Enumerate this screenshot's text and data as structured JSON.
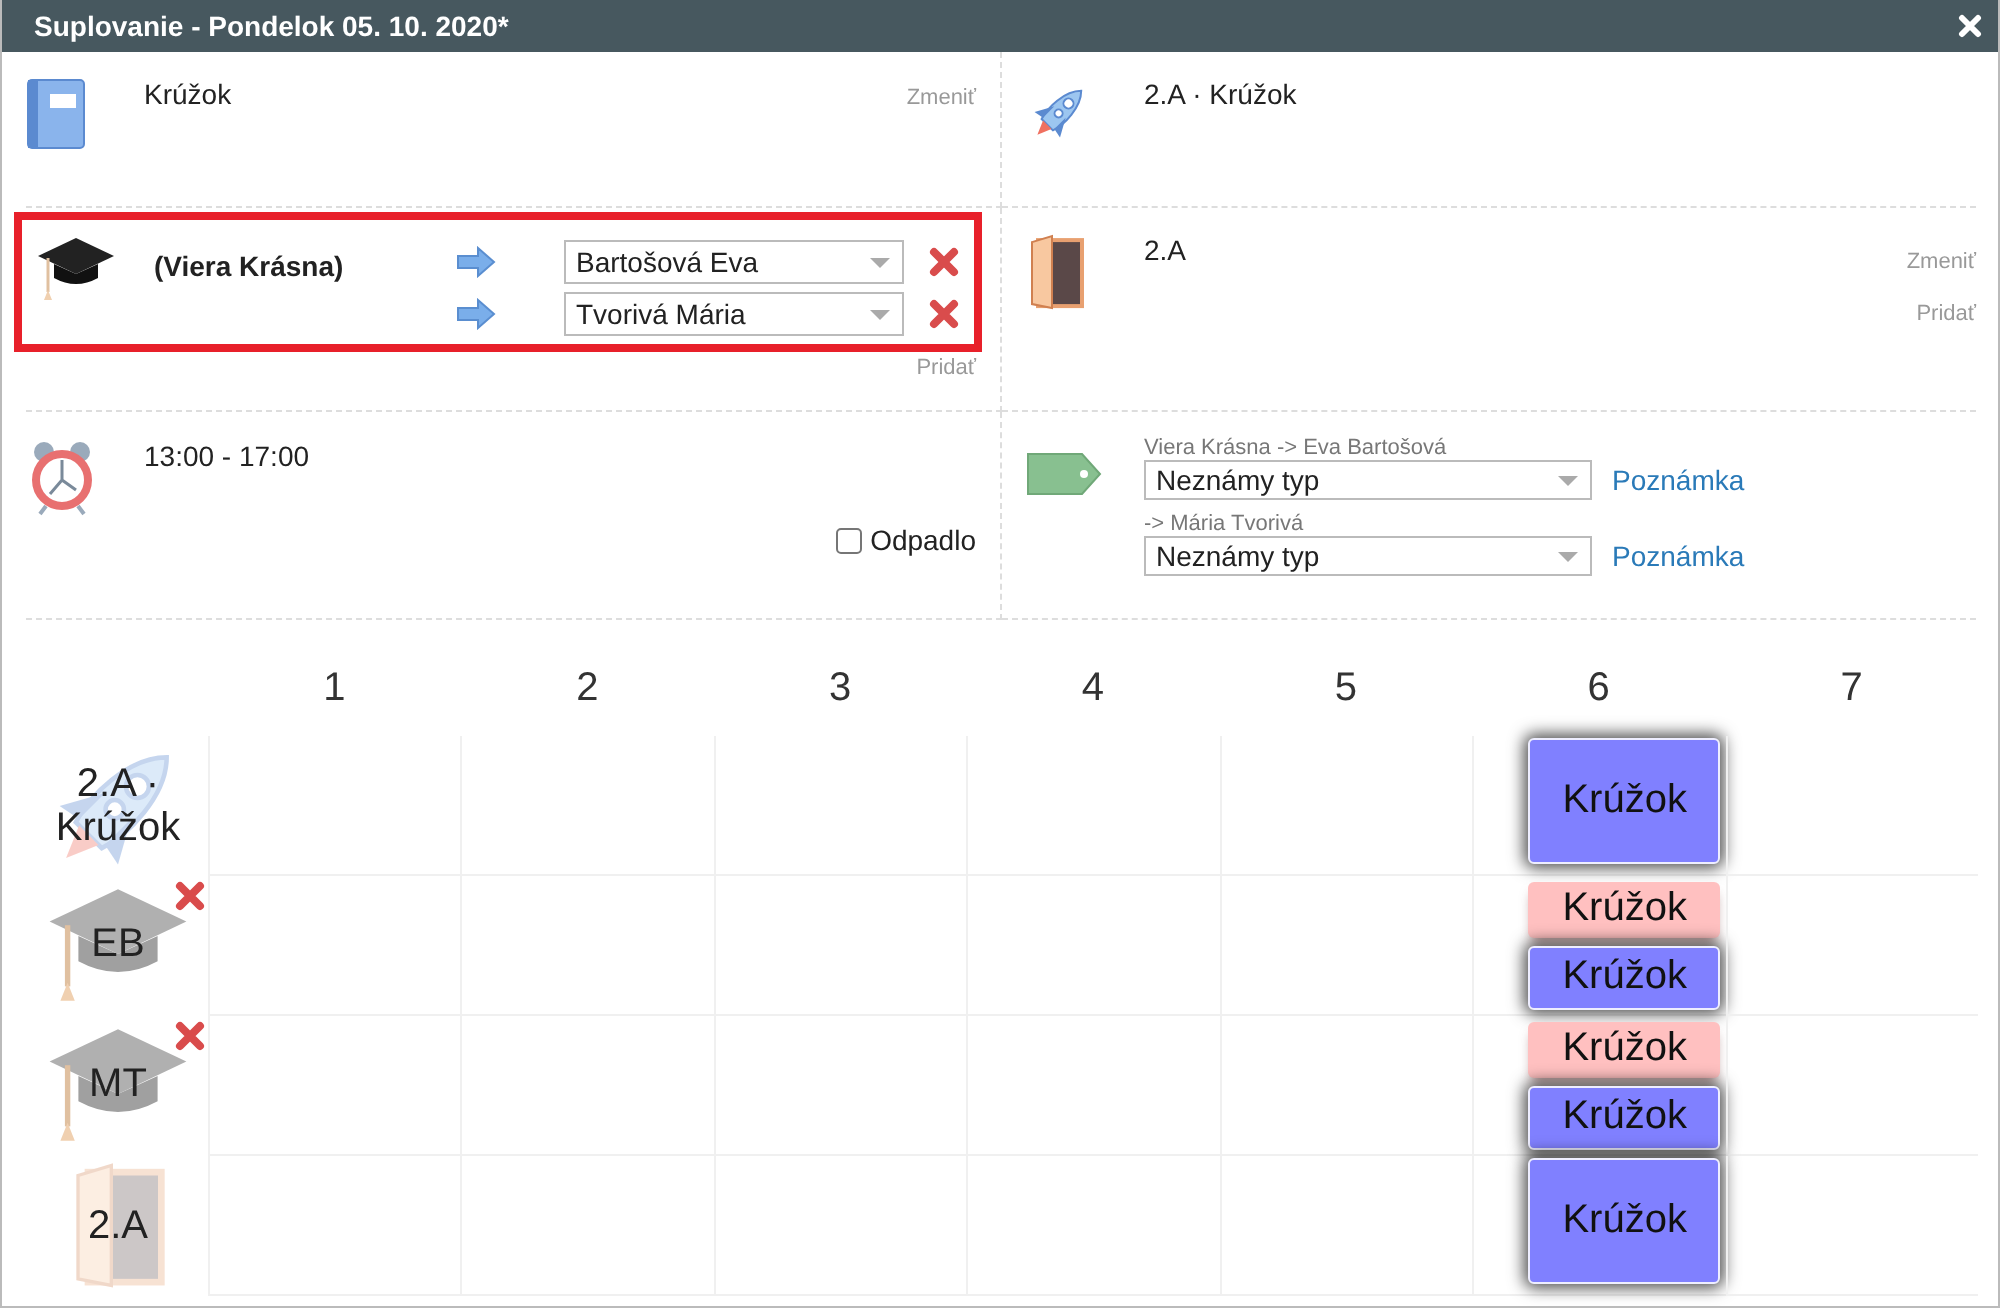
{
  "window": {
    "title": "Suplovanie - Pondelok 05. 10. 2020*"
  },
  "subject": {
    "name": "Krúžok",
    "change_link": "Zmeniť"
  },
  "group": {
    "name": "2.A · Krúžok"
  },
  "teachers": {
    "original": "(Viera Krásna)",
    "highlighted": true,
    "add_link": "Pridať",
    "substitutes": [
      {
        "value": "Bartošová Eva"
      },
      {
        "value": "Tvorivá Mária"
      }
    ]
  },
  "classroom": {
    "name": "2.A",
    "change_link": "Zmeniť",
    "add_link": "Pridať"
  },
  "time": {
    "range": "13:00 - 17:00",
    "cancelled": {
      "label": "Odpadlo",
      "checked": false
    }
  },
  "types": [
    {
      "label": "Viera Krásna -> Eva Bartošová",
      "value": "Neznámy typ",
      "note_link": "Poznámka"
    },
    {
      "label": "-> Mária Tvorivá",
      "value": "Neznámy typ",
      "note_link": "Poznámka"
    }
  ],
  "timetable": {
    "columns": [
      "1",
      "2",
      "3",
      "4",
      "5",
      "6",
      "7"
    ],
    "rows": [
      {
        "kind": "group",
        "label": "2.A · Krúžok",
        "removable": false,
        "cells": [
          {},
          {},
          {},
          {},
          {},
          {
            "cards": [
              {
                "label": "Krúžok",
                "kind": "current"
              }
            ]
          },
          {}
        ]
      },
      {
        "kind": "teacher",
        "label": "EB",
        "removable": true,
        "cells": [
          {},
          {},
          {},
          {},
          {},
          {
            "cards": [
              {
                "label": "Krúžok",
                "kind": "removed"
              },
              {
                "label": "Krúžok",
                "kind": "current"
              }
            ]
          },
          {}
        ]
      },
      {
        "kind": "teacher",
        "label": "MT",
        "removable": true,
        "cells": [
          {},
          {},
          {},
          {},
          {},
          {
            "cards": [
              {
                "label": "Krúžok",
                "kind": "removed"
              },
              {
                "label": "Krúžok",
                "kind": "current"
              }
            ]
          },
          {}
        ]
      },
      {
        "kind": "room",
        "label": "2.A",
        "removable": false,
        "cells": [
          {},
          {},
          {},
          {},
          {},
          {
            "cards": [
              {
                "label": "Krúžok",
                "kind": "current"
              }
            ]
          },
          {}
        ]
      }
    ]
  }
}
